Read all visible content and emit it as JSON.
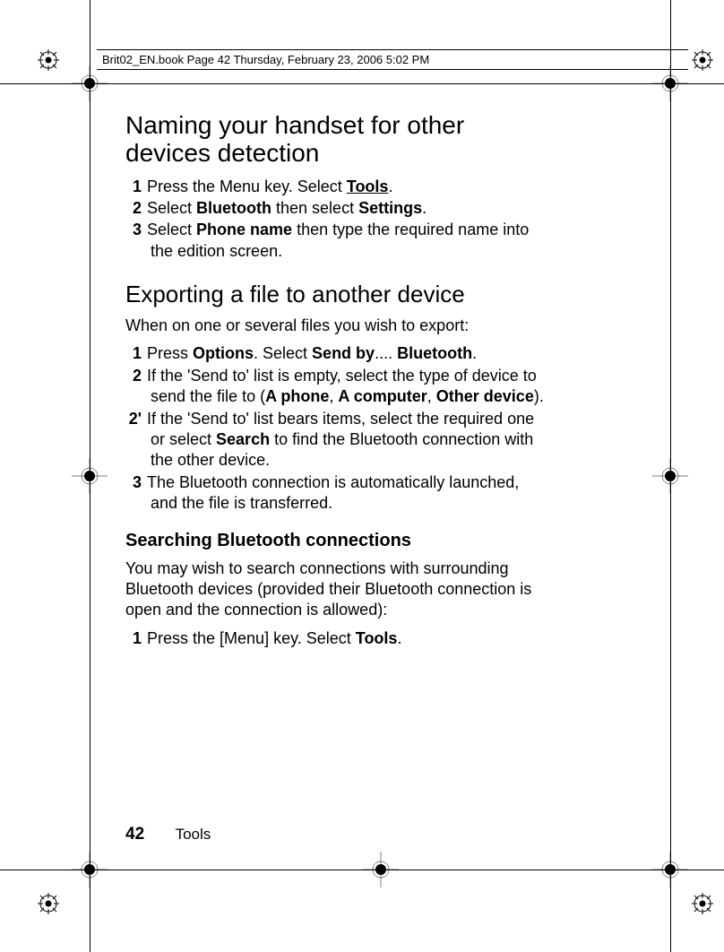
{
  "header": "Brit02_EN.book  Page 42  Thursday, February 23, 2006  5:02 PM",
  "h1": "Naming your handset for other devices detection",
  "steps1": {
    "s1": {
      "num": "1",
      "pre": "Press the Menu key. Select ",
      "b1": "Tools",
      "post": "."
    },
    "s2": {
      "num": "2",
      "pre": "Select ",
      "b1": "Bluetooth",
      "mid": " then select ",
      "b2": "Settings",
      "post": "."
    },
    "s3": {
      "num": "3",
      "pre": "Select ",
      "b1": "Phone name",
      "post": " then type the required name into the edition screen."
    }
  },
  "h2": "Exporting a file to another device",
  "intro1": "When on one or several files you wish to export:",
  "steps2": {
    "s1": {
      "num": "1",
      "pre": "Press ",
      "b1": "Options",
      "mid": ". Select ",
      "b2": "Send by",
      "mid2": ".... ",
      "b3": "Bluetooth",
      "post": "."
    },
    "s2": {
      "num": "2",
      "pre": "If the 'Send to' list is empty, select the type of device to send the file to (",
      "b1": "A phone",
      "mid": ", ",
      "b2": "A computer",
      "mid2": ", ",
      "b3": "Other device",
      "post": ")."
    },
    "s2p": {
      "num": "2'",
      "pre": "If the 'Send to' list bears items, select the required one or select ",
      "b1": "Search",
      "post": " to find the Bluetooth connection with the other device."
    },
    "s3": {
      "num": "3",
      "pre": "The Bluetooth connection is automatically launched, and the file is transferred."
    }
  },
  "h3": "Searching Bluetooth connections",
  "intro2": "You may wish to search connections with surrounding Bluetooth devices (provided their Bluetooth connection is open and the connection is allowed):",
  "steps3": {
    "s1": {
      "num": "1",
      "pre": "Press the [Menu] key. Select ",
      "b1": "Tools",
      "post": "."
    }
  },
  "footer": {
    "pageno": "42",
    "section": "Tools"
  }
}
